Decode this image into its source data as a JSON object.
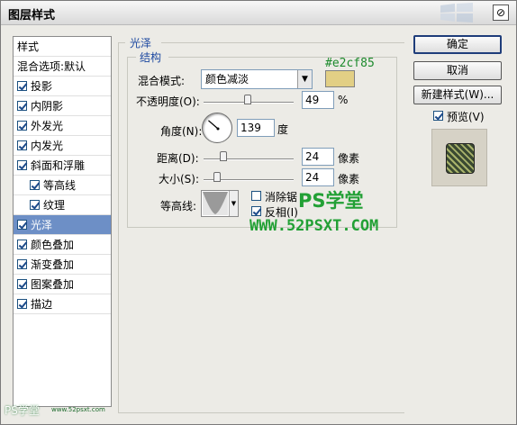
{
  "window": {
    "title": "图层样式",
    "close_glyph": "⊘"
  },
  "sidebar": {
    "items": [
      {
        "label": "样式",
        "checkbox": false,
        "checked": false,
        "indent": false,
        "active": false
      },
      {
        "label": "混合选项:默认",
        "checkbox": false,
        "checked": false,
        "indent": false,
        "active": false
      },
      {
        "label": "投影",
        "checkbox": true,
        "checked": true,
        "indent": false,
        "active": false
      },
      {
        "label": "内阴影",
        "checkbox": true,
        "checked": true,
        "indent": false,
        "active": false
      },
      {
        "label": "外发光",
        "checkbox": true,
        "checked": true,
        "indent": false,
        "active": false
      },
      {
        "label": "内发光",
        "checkbox": true,
        "checked": true,
        "indent": false,
        "active": false
      },
      {
        "label": "斜面和浮雕",
        "checkbox": true,
        "checked": true,
        "indent": false,
        "active": false
      },
      {
        "label": "等高线",
        "checkbox": true,
        "checked": true,
        "indent": true,
        "active": false
      },
      {
        "label": "纹理",
        "checkbox": true,
        "checked": true,
        "indent": true,
        "active": false
      },
      {
        "label": "光泽",
        "checkbox": true,
        "checked": true,
        "indent": false,
        "active": true
      },
      {
        "label": "颜色叠加",
        "checkbox": true,
        "checked": true,
        "indent": false,
        "active": false
      },
      {
        "label": "渐变叠加",
        "checkbox": true,
        "checked": true,
        "indent": false,
        "active": false
      },
      {
        "label": "图案叠加",
        "checkbox": true,
        "checked": true,
        "indent": false,
        "active": false
      },
      {
        "label": "描边",
        "checkbox": true,
        "checked": true,
        "indent": false,
        "active": false
      }
    ]
  },
  "satin": {
    "section_title": "光泽",
    "structure_title": "结构",
    "blend_mode_label": "混合模式:",
    "blend_mode_value": "颜色减淡",
    "color_hex_annotation": "#e2cf85",
    "color": "#e2cf85",
    "opacity_label": "不透明度(O):",
    "opacity_value": "49",
    "opacity_unit": "%",
    "angle_label": "角度(N):",
    "angle_value": "139",
    "angle_unit": "度",
    "distance_label": "距离(D):",
    "distance_value": "24",
    "distance_unit": "像素",
    "size_label": "大小(S):",
    "size_value": "24",
    "size_unit": "像素",
    "contour_label": "等高线:",
    "antialias_label": "消除锯齿(L)",
    "antialias_checked": false,
    "invert_label": "反相(I)",
    "invert_checked": true
  },
  "buttons": {
    "ok": "确定",
    "cancel": "取消",
    "new_style": "新建样式(W)...",
    "preview_label": "预览(V)",
    "preview_checked": true
  },
  "watermarks": {
    "main_title": "PS学堂",
    "main_url": "WWW.52PSXT.COM",
    "corner": "PS学堂",
    "corner_url": "www.52psxt.com"
  },
  "colors": {
    "accent": "#1c48a0",
    "selection": "#6d8fc6",
    "watermark": "#22a035"
  }
}
